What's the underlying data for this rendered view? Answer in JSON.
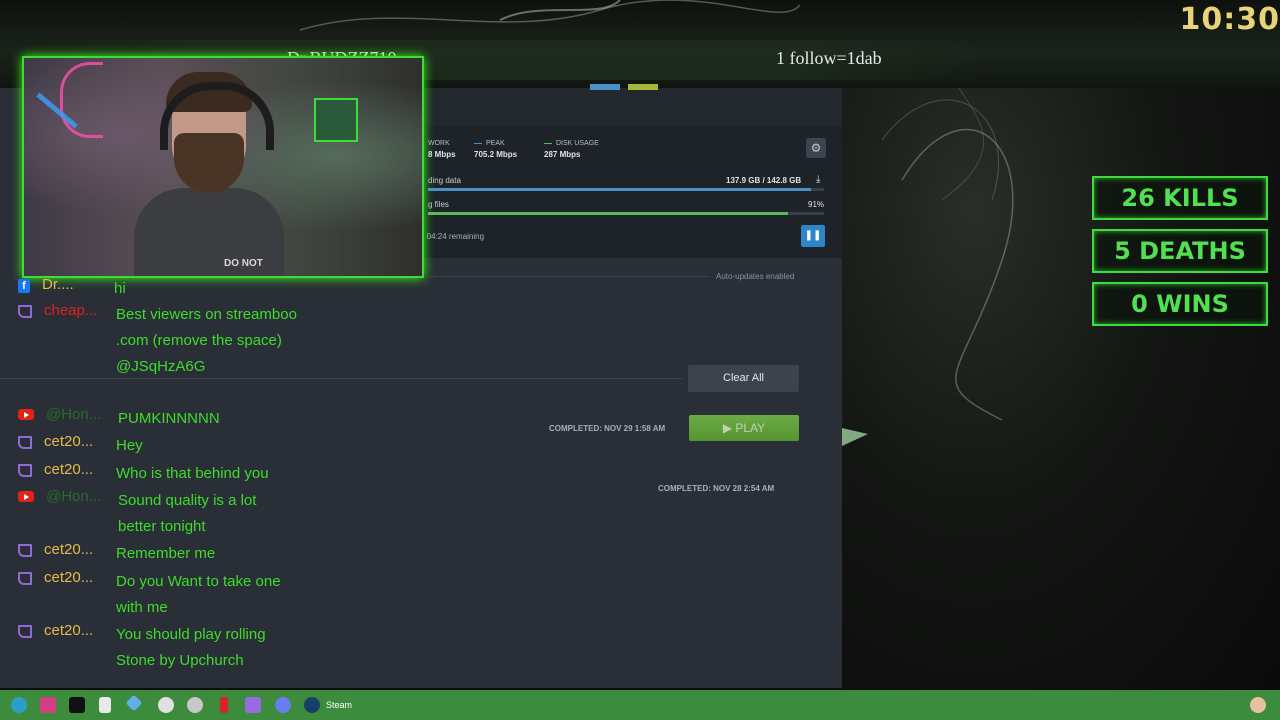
{
  "overlay": {
    "streamer_name": "Dr.BUDZZ710",
    "follow_goal": "1 follow=1dab",
    "clock": "10:30",
    "scores": {
      "kills": "26 KILLS",
      "deaths": "5 DEATHS",
      "wins": "0 WINS"
    },
    "webcam_shirt_text": "DO NOT"
  },
  "steam": {
    "stats": {
      "network_label": "WORK",
      "network_value": "8 Mbps",
      "peak_label": "PEAK",
      "peak_value": "705.2 Mbps",
      "disk_label": "DISK USAGE",
      "disk_value": "287 Mbps"
    },
    "download_row_label": "ding data",
    "download_row_value": "137.9 GB / 142.8 GB",
    "download_progress": 0.966,
    "verify_row_label": "g files",
    "verify_row_value": "91%",
    "verify_progress": 0.91,
    "remaining": "d 04:24 remaining",
    "auto_updates": "Auto-updates enabled",
    "clear_all": "Clear All",
    "completed_1": "COMPLETED: NOV 29 1:58 AM",
    "play": "PLAY",
    "completed_2": "COMPLETED: NOV 28 2:54 AM",
    "colors": {
      "accent_blue": "#2e86c9",
      "play_green": "#5ca82f"
    }
  },
  "chat": [
    {
      "platform": "facebook",
      "user": "Dr....",
      "text": "hi"
    },
    {
      "platform": "twitch",
      "user": "cheap...",
      "text": "Best viewers on streamboo .com (remove the space) @JSqHzA6G"
    },
    {
      "platform": "youtube",
      "user": "@Hon...",
      "text": "PUMKINNNNN"
    },
    {
      "platform": "twitch",
      "user": "cet20...",
      "text": "Hey"
    },
    {
      "platform": "twitch",
      "user": "cet20...",
      "text": "Who is that behind you"
    },
    {
      "platform": "youtube",
      "user": "@Hon...",
      "text": "Sound quality is a lot better tonight"
    },
    {
      "platform": "twitch",
      "user": "cet20...",
      "text": "Remember me"
    },
    {
      "platform": "twitch",
      "user": "cet20...",
      "text": "Do you Want to take one with me"
    },
    {
      "platform": "twitch",
      "user": "cet20...",
      "text": "You should play rolling Stone by Upchurch"
    }
  ],
  "taskbar": {
    "active_app_label": "Steam",
    "icons": [
      "edge-icon",
      "instagram-icon",
      "tiktok-icon",
      "file-icon",
      "gem-icon",
      "obs-icon",
      "steam-icon",
      "red-app-icon",
      "twitch-icon",
      "discord-icon",
      "steam-taskbar-icon"
    ]
  }
}
